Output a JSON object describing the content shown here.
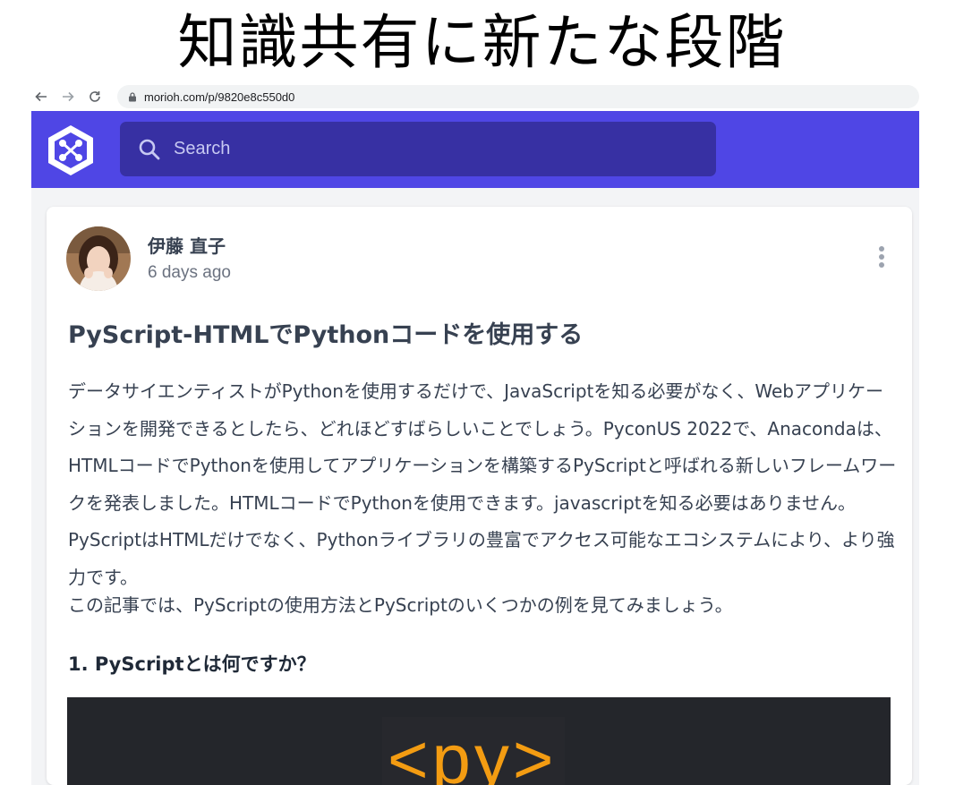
{
  "banner": {
    "title": "知識共有に新たな段階"
  },
  "browser": {
    "url": "morioh.com/p/9820e8c550d0",
    "back_icon": "arrow-left-icon",
    "forward_icon": "arrow-right-icon",
    "reload_icon": "reload-icon",
    "lock_icon": "lock-icon"
  },
  "header": {
    "logo_icon": "morioh-logo",
    "search": {
      "placeholder": "Search",
      "icon": "search-icon"
    },
    "accent": "#4f46e5",
    "search_bg": "#3730a3"
  },
  "post": {
    "author": "伊藤 直子",
    "time": "6 days ago",
    "menu_icon": "more-vertical-icon",
    "title": "PyScript-HTMLでPythonコードを使用する",
    "paragraphs": [
      "データサイエンティストがPythonを使用するだけで、JavaScriptを知る必要がなく、Webアプリケーションを開発できるとしたら、どれほどすばらしいことでしょう。PyconUS 2022で、Anacondaは、HTMLコードでPythonを使用してアプリケーションを構築するPyScriptと呼ばれる新しいフレームワークを発表しました。HTMLコードでPythonを使用できます。javascriptを知る必要はありません。PyScriptはHTMLだけでなく、Pythonライブラリの豊富でアクセス可能なエコシステムにより、より強力です。",
      "この記事では、PyScriptの使用方法とPyScriptのいくつかの例を見てみましょう。"
    ],
    "section_heading": "1. PyScriptとは何ですか？",
    "hero_text": "<py>"
  }
}
